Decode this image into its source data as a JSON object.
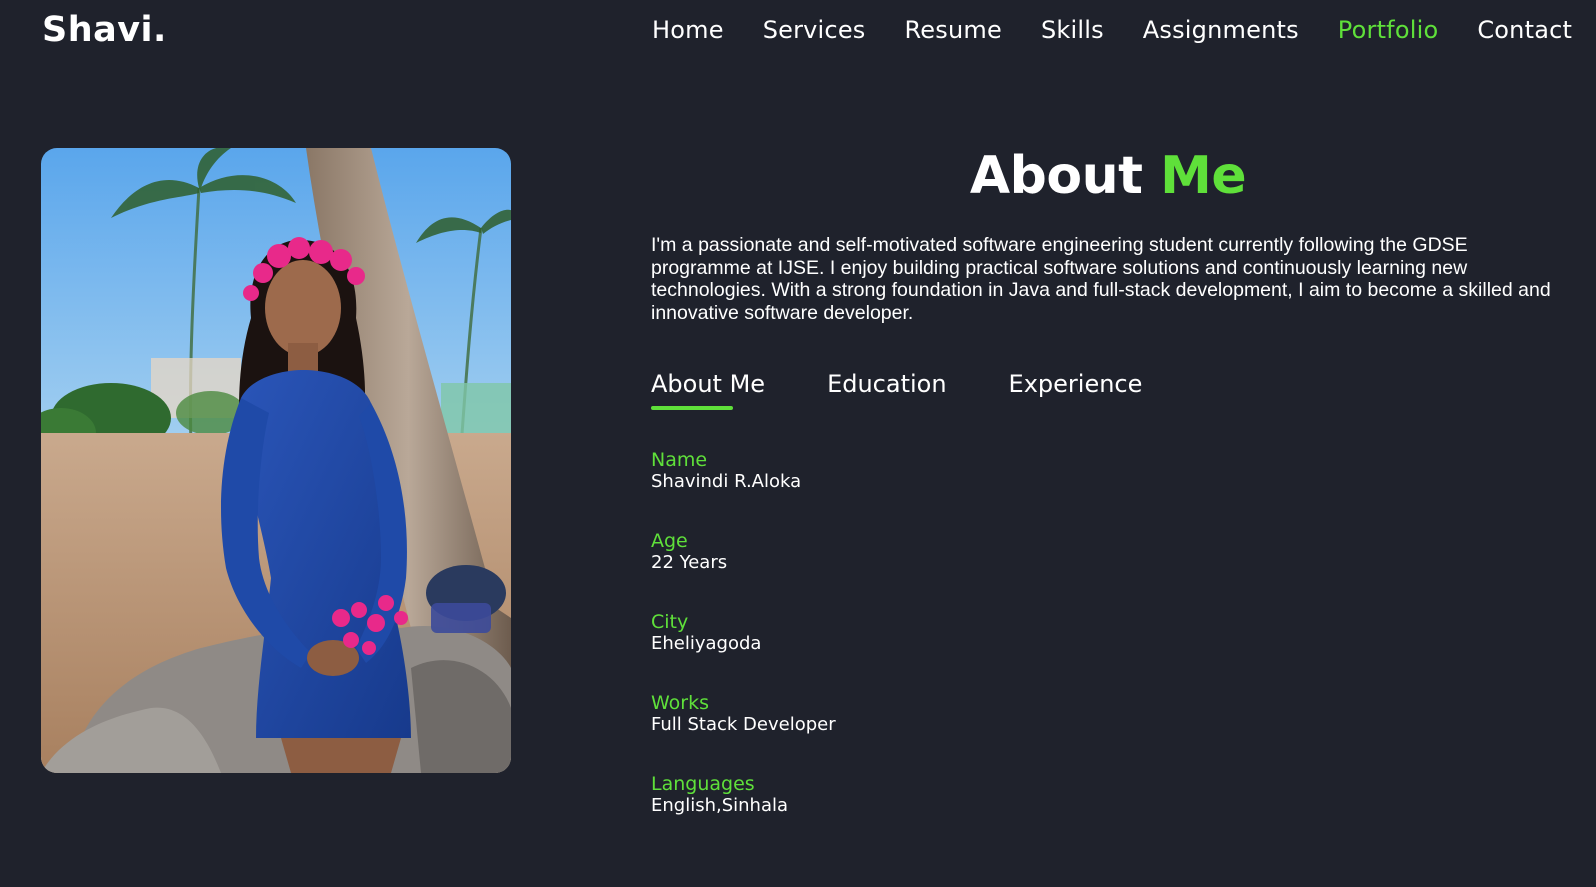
{
  "header": {
    "logo": "Shavi.",
    "nav": [
      {
        "label": "Home",
        "active": false
      },
      {
        "label": "Services",
        "active": false
      },
      {
        "label": "Resume",
        "active": false
      },
      {
        "label": "Skills",
        "active": false
      },
      {
        "label": "Assignments",
        "active": false
      },
      {
        "label": "Portfolio",
        "active": true
      },
      {
        "label": "Contact",
        "active": false
      }
    ]
  },
  "about": {
    "title_main": "About",
    "title_accent": "Me",
    "intro": "I'm a passionate and self-motivated software engineering student currently following the GDSE programme at IJSE. I enjoy building practical software solutions and continuously learning new technologies. With a strong foundation in Java and full-stack development, I aim to become a skilled and innovative software developer.",
    "tabs": [
      {
        "label": "About Me",
        "active": true
      },
      {
        "label": "Education",
        "active": false
      },
      {
        "label": "Experience",
        "active": false
      }
    ],
    "info": [
      {
        "label": "Name",
        "value": "Shavindi R.Aloka"
      },
      {
        "label": "Age",
        "value": "22 Years"
      },
      {
        "label": "City",
        "value": "Eheliyagoda"
      },
      {
        "label": "Works",
        "value": "Full Stack Developer"
      },
      {
        "label": "Languages",
        "value": "English,Sinhala"
      }
    ]
  },
  "colors": {
    "background": "#1f222c",
    "accent": "#5fe03a",
    "text": "#ffffff"
  }
}
